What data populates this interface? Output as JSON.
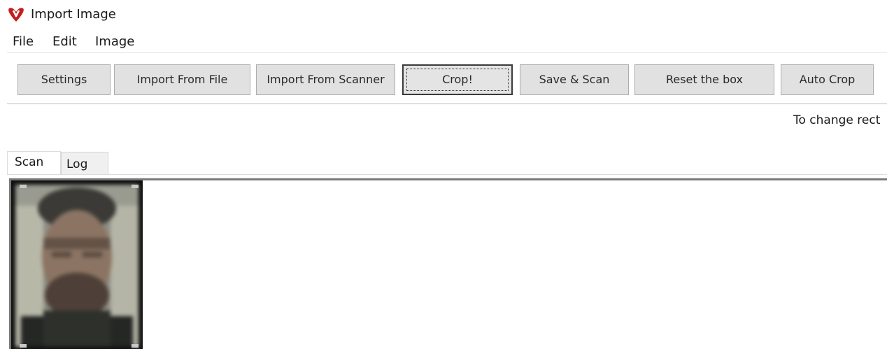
{
  "window": {
    "title": "Import Image",
    "logo_icon": "v-logo-icon",
    "logo_color": "#c41e1e"
  },
  "menu": [
    {
      "label": "File"
    },
    {
      "label": "Edit"
    },
    {
      "label": "Image"
    }
  ],
  "toolbar": {
    "buttons": [
      {
        "label": "Settings"
      },
      {
        "label": "Import From File"
      },
      {
        "label": "Import From Scanner"
      },
      {
        "label": "Crop!"
      },
      {
        "label": "Save & Scan"
      },
      {
        "label": "Reset the box"
      },
      {
        "label": "Auto Crop"
      }
    ]
  },
  "hint_text": "To change rect",
  "tabs": [
    {
      "label": "Scan",
      "selected": true
    },
    {
      "label": "Log",
      "selected": false
    }
  ],
  "scan_image": {
    "description_icon": "blurred-face-photo"
  }
}
